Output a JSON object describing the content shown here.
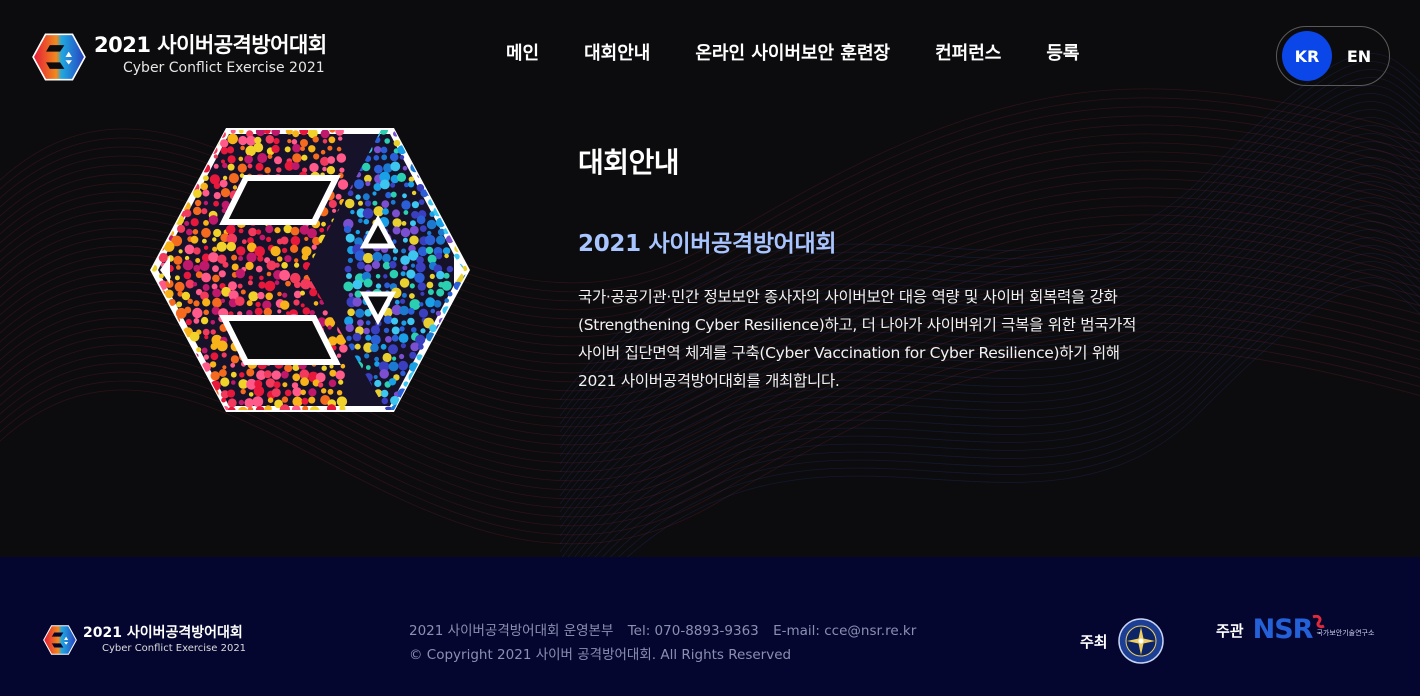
{
  "header": {
    "brand_title": "2021 사이버공격방어대회",
    "brand_subtitle": "Cyber Conflict Exercise 2021",
    "nav": [
      {
        "label": "메인"
      },
      {
        "label": "대회안내"
      },
      {
        "label": "온라인 사이버보안 훈련장"
      },
      {
        "label": "컨퍼런스"
      },
      {
        "label": "등록"
      }
    ],
    "lang": {
      "active": "KR",
      "inactive": "EN"
    }
  },
  "main": {
    "section_title": "대회안내",
    "event_title": "2021 사이버공격방어대회",
    "description": [
      "국가·공공기관·민간 정보보안 종사자의 사이버보안 대응 역량 및 사이버 회복력을 강화",
      "(Strengthening Cyber Resilience)하고, 더 나아가 사이버위기 극복을 위한 범국가적",
      "사이버 집단면역 체계를 구축(Cyber Vaccination for Cyber Resilience)하기 위해",
      "2021 사이버공격방어대회를 개최합니다."
    ]
  },
  "footer": {
    "brand_title": "2021 사이버공격방어대회",
    "brand_subtitle": "Cyber Conflict Exercise 2021",
    "organizer": "2021 사이버공격방어대회 운영본부",
    "tel": "Tel: 070-8893-9363",
    "email": "E-mail: cce@nsr.re.kr",
    "copyright": "© Copyright 2021 사이버 공격방어대회. All Rights Reserved",
    "host_label": "주최",
    "org_label": "주관",
    "org_logo_text": "NSR",
    "org_name": "국가보안기술연구소"
  },
  "colors": {
    "accent": "#0a46e8",
    "event_title": "#a9c5ff",
    "footer_bg": "#050630",
    "nsr_blue": "#2460d8",
    "nsr_red": "#e0293b"
  },
  "icons": {
    "brand": "cce-hexagon-logo",
    "host": "nis-seal-icon",
    "org": "nsr-logo"
  }
}
